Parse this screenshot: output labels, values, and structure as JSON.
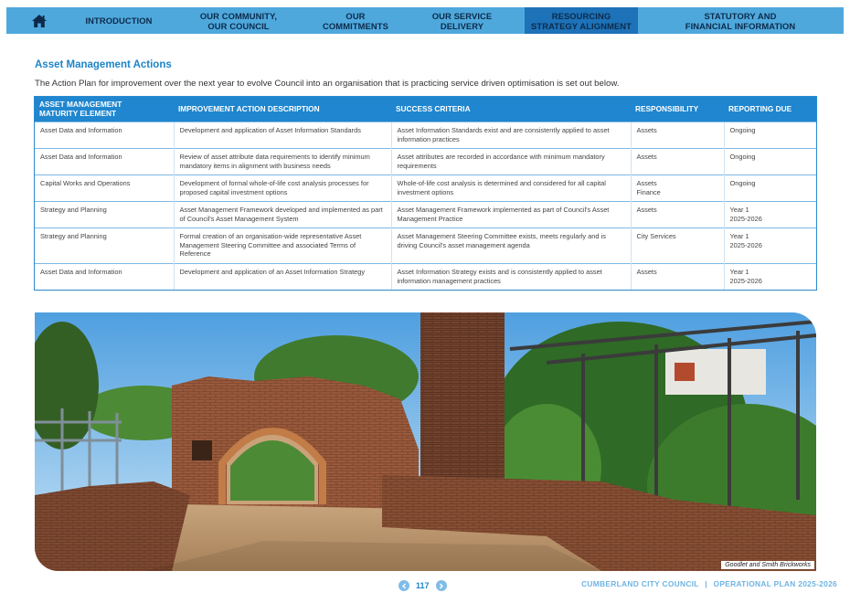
{
  "nav": {
    "home_icon": "home-icon",
    "items": [
      {
        "line1": "INTRODUCTION",
        "line2": ""
      },
      {
        "line1": "OUR COMMUNITY,",
        "line2": "OUR COUNCIL"
      },
      {
        "line1": "OUR",
        "line2": "COMMITMENTS"
      },
      {
        "line1": "OUR SERVICE",
        "line2": "DELIVERY"
      },
      {
        "line1": "RESOURCING",
        "line2": "STRATEGY ALIGNMENT"
      },
      {
        "line1": "STATUTORY AND",
        "line2": "FINANCIAL INFORMATION"
      }
    ],
    "active_index": 4,
    "colors": {
      "bar": "#4ea8dc",
      "active": "#1d72b8",
      "text": "#0d2a4a"
    }
  },
  "section": {
    "title": "Asset Management Actions",
    "intro": "The Action Plan for improvement over the next year to evolve Council into an organisation that is practicing service driven optimisation is set out below."
  },
  "table": {
    "headers": {
      "c1_line1": "ASSET MANAGEMENT",
      "c1_line2": "MATURITY ELEMENT",
      "c2": "IMPROVEMENT ACTION DESCRIPTION",
      "c3": "SUCCESS CRITERIA",
      "c4": "RESPONSIBILITY",
      "c5": "REPORTING DUE"
    },
    "rows": [
      {
        "element": "Asset Data and Information",
        "action": "Development and application of Asset Information Standards",
        "criteria": "Asset Information Standards exist and are consistently applied to asset information practices",
        "responsibility": [
          "Assets"
        ],
        "due": [
          "Ongoing"
        ]
      },
      {
        "element": "Asset Data and Information",
        "action": "Review of asset attribute data requirements to identify minimum mandatory items in alignment with business needs",
        "criteria": "Asset attributes are recorded in accordance with minimum mandatory requirements",
        "responsibility": [
          "Assets"
        ],
        "due": [
          "Ongoing"
        ]
      },
      {
        "element": "Capital Works and Operations",
        "action": "Development of formal whole-of-life cost analysis processes for proposed capital investment options",
        "criteria": "Whole-of-life cost analysis is determined and considered for all capital investment options",
        "responsibility": [
          "Assets",
          "Finance"
        ],
        "due": [
          "Ongoing"
        ]
      },
      {
        "element": "Strategy and Planning",
        "action": "Asset Management Framework developed and implemented as part of Council's Asset Management System",
        "criteria": "Asset Management Framework implemented as part of Council's Asset Management Practice",
        "responsibility": [
          "Assets"
        ],
        "due": [
          "Year 1",
          "2025-2026"
        ]
      },
      {
        "element": "Strategy and Planning",
        "action": "Formal creation of an organisation-wide representative Asset Management Steering Committee and associated Terms of Reference",
        "criteria": "Asset Management Steering Committee exists, meets regularly and is driving Council's asset management agenda",
        "responsibility": [
          "City Services"
        ],
        "due": [
          "Year 1",
          "2025-2026"
        ]
      },
      {
        "element": "Asset Data and Information",
        "action": "Development and application of an Asset Information Strategy",
        "criteria": "Asset Information Strategy exists and is consistently applied to asset information management practices",
        "responsibility": [
          "Assets"
        ],
        "due": [
          "Year 1",
          "2025-2026"
        ]
      }
    ]
  },
  "photo": {
    "caption": "Goodlet and Smith Brickworks"
  },
  "footer": {
    "page_number": "117",
    "prev_icon": "chevron-left-icon",
    "next_icon": "chevron-right-icon",
    "council": "CUMBERLAND CITY COUNCIL",
    "separator": "|",
    "plan": "OPERATIONAL PLAN 2025-2026"
  }
}
